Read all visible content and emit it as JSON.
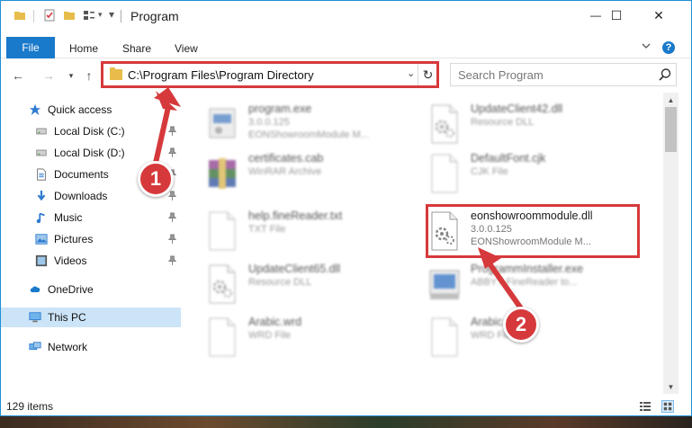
{
  "window": {
    "title": "Program",
    "minimize_glyph": "—",
    "maximize_glyph": "☐",
    "close_glyph": "✕"
  },
  "ribbon": {
    "tabs": [
      "File",
      "Home",
      "Share",
      "View"
    ],
    "help_glyph": "?"
  },
  "address_bar": {
    "path": "C:\\Program Files\\Program Directory",
    "dropdown_glyph": "⌄",
    "refresh_glyph": "↻"
  },
  "search": {
    "placeholder": "Search Program"
  },
  "nav_pane": {
    "items": [
      {
        "label": "Quick access",
        "icon": "star-icon",
        "pinned": false
      },
      {
        "label": "Local Disk (C:)",
        "icon": "drive-icon",
        "pinned": true
      },
      {
        "label": "Local Disk (D:)",
        "icon": "drive-icon",
        "pinned": true
      },
      {
        "label": "Documents",
        "icon": "documents-icon",
        "pinned": true
      },
      {
        "label": "Downloads",
        "icon": "download-icon",
        "pinned": true
      },
      {
        "label": "Music",
        "icon": "music-icon",
        "pinned": true
      },
      {
        "label": "Pictures",
        "icon": "pictures-icon",
        "pinned": true
      },
      {
        "label": "Videos",
        "icon": "videos-icon",
        "pinned": true
      },
      {
        "label": "OneDrive",
        "icon": "cloud-icon",
        "pinned": false
      },
      {
        "label": "This PC",
        "icon": "computer-icon",
        "pinned": false,
        "selected": true
      },
      {
        "label": "Network",
        "icon": "network-icon",
        "pinned": false
      }
    ]
  },
  "files": [
    {
      "name": "program.exe",
      "line2": "3.0.0.125",
      "line3": "EONShowroomModule M...",
      "icon": "exe-icon",
      "blurred": true
    },
    {
      "name": "UpdateClient42.dll",
      "line2": "Resource DLL",
      "line3": "",
      "icon": "dll-icon",
      "blurred": true
    },
    {
      "name": "certificates.cab",
      "line2": "WinRAR Archive",
      "line3": "",
      "icon": "archive-icon",
      "blurred": true
    },
    {
      "name": "DefaultFont.cjk",
      "line2": "CJK File",
      "line3": "",
      "icon": "file-icon",
      "blurred": true
    },
    {
      "name": "help.fineReader.txt",
      "line2": "TXT File",
      "line3": "",
      "icon": "file-icon",
      "blurred": true
    },
    {
      "name": "eonshowroommodule.dll",
      "line2": "3.0.0.125",
      "line3": "EONShowroomModule M...",
      "icon": "dll-icon",
      "blurred": false
    },
    {
      "name": "UpdateClient65.dll",
      "line2": "Resource DLL",
      "line3": "",
      "icon": "dll-icon",
      "blurred": true
    },
    {
      "name": "ProgrammInstaller.exe",
      "line2": "ABBYY FineReader to...",
      "line3": "",
      "icon": "installer-icon",
      "blurred": true
    },
    {
      "name": "Arabic.wrd",
      "line2": "WRD File",
      "line3": "",
      "icon": "file-icon",
      "blurred": true
    },
    {
      "name": "Arabic.wrd",
      "line2": "WRD File",
      "line3": "",
      "icon": "file-icon",
      "blurred": true
    }
  ],
  "status": {
    "item_count": "129 items"
  },
  "callouts": [
    "1",
    "2"
  ],
  "colors": {
    "accent": "#1979ca",
    "highlight": "#d6393c",
    "selection": "#cce4f7"
  }
}
